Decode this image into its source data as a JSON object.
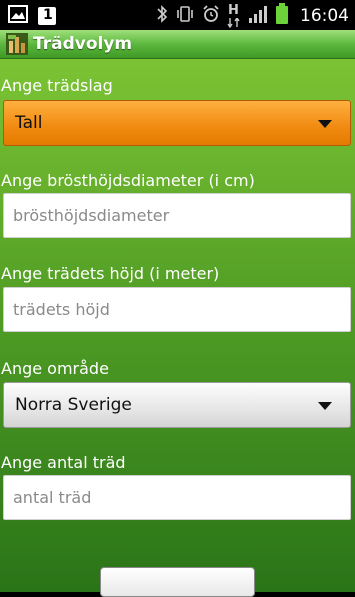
{
  "status_bar": {
    "icons_left": [
      "image-icon",
      "notification-one-icon"
    ],
    "notification_count": "1",
    "icons_right": [
      "bluetooth-icon",
      "vibrate-icon",
      "alarm-icon",
      "data-h-icon",
      "signal-icon",
      "battery-icon"
    ],
    "data_type": "H",
    "time": "16:04"
  },
  "app": {
    "title": "Trädvolym"
  },
  "form": {
    "species": {
      "label": "Ange trädslag",
      "value": "Tall"
    },
    "diameter": {
      "label": "Ange brösthöjdsdiameter (i cm)",
      "placeholder": "brösthöjdsdiameter"
    },
    "height": {
      "label": "Ange trädets höjd (i meter)",
      "placeholder": "trädets höjd"
    },
    "region": {
      "label": "Ange område",
      "value": "Norra Sverige"
    },
    "count": {
      "label": "Ange antal träd",
      "placeholder": "antal träd"
    }
  },
  "colors": {
    "title_green": "#58b43a",
    "background_green": "#4e9b24",
    "spinner_orange": "#f08a10"
  }
}
